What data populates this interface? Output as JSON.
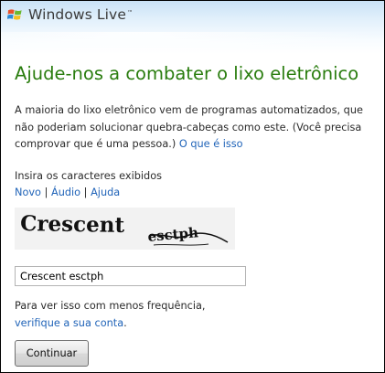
{
  "header": {
    "brand": "Windows Live",
    "trademark": "™"
  },
  "page": {
    "title": "Ajude-nos a combater o lixo eletrônico",
    "description": "A maioria do lixo eletrônico vem de programas automatizados, que não poderiam solucionar quebra-cabeças como este. (Você precisa comprovar que é uma pessoa.)",
    "what_is_this_link": "O que é isso"
  },
  "captcha": {
    "instruction": "Insira os caracteres exibidos",
    "new_link": "Novo",
    "audio_link": "Áudio",
    "help_link": "Ajuda",
    "separator": "|",
    "image_word1": "Crescent",
    "image_word2": "esctph",
    "input_value": "Crescent esctph"
  },
  "note": {
    "text": "Para ver isso com menos frequência,",
    "verify_link": "verifique a sua conta",
    "period": "."
  },
  "actions": {
    "continue_label": "Continuar"
  },
  "colors": {
    "title_green": "#2a7d0f",
    "link_blue": "#1f63b8"
  }
}
